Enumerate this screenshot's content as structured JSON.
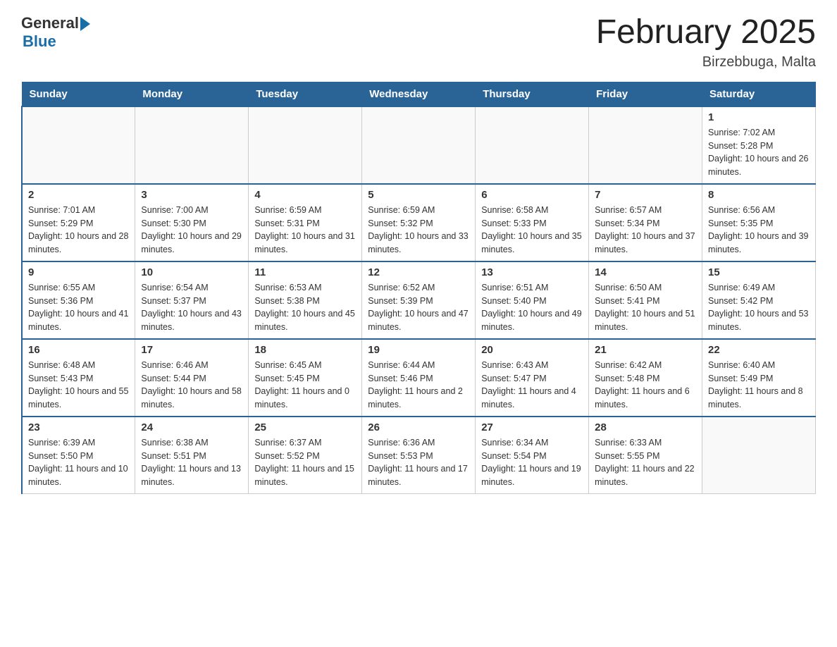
{
  "logo": {
    "general_text": "General",
    "blue_text": "Blue"
  },
  "title": "February 2025",
  "location": "Birzebbuga, Malta",
  "days_of_week": [
    "Sunday",
    "Monday",
    "Tuesday",
    "Wednesday",
    "Thursday",
    "Friday",
    "Saturday"
  ],
  "weeks": [
    [
      {
        "day": "",
        "info": ""
      },
      {
        "day": "",
        "info": ""
      },
      {
        "day": "",
        "info": ""
      },
      {
        "day": "",
        "info": ""
      },
      {
        "day": "",
        "info": ""
      },
      {
        "day": "",
        "info": ""
      },
      {
        "day": "1",
        "info": "Sunrise: 7:02 AM\nSunset: 5:28 PM\nDaylight: 10 hours and 26 minutes."
      }
    ],
    [
      {
        "day": "2",
        "info": "Sunrise: 7:01 AM\nSunset: 5:29 PM\nDaylight: 10 hours and 28 minutes."
      },
      {
        "day": "3",
        "info": "Sunrise: 7:00 AM\nSunset: 5:30 PM\nDaylight: 10 hours and 29 minutes."
      },
      {
        "day": "4",
        "info": "Sunrise: 6:59 AM\nSunset: 5:31 PM\nDaylight: 10 hours and 31 minutes."
      },
      {
        "day": "5",
        "info": "Sunrise: 6:59 AM\nSunset: 5:32 PM\nDaylight: 10 hours and 33 minutes."
      },
      {
        "day": "6",
        "info": "Sunrise: 6:58 AM\nSunset: 5:33 PM\nDaylight: 10 hours and 35 minutes."
      },
      {
        "day": "7",
        "info": "Sunrise: 6:57 AM\nSunset: 5:34 PM\nDaylight: 10 hours and 37 minutes."
      },
      {
        "day": "8",
        "info": "Sunrise: 6:56 AM\nSunset: 5:35 PM\nDaylight: 10 hours and 39 minutes."
      }
    ],
    [
      {
        "day": "9",
        "info": "Sunrise: 6:55 AM\nSunset: 5:36 PM\nDaylight: 10 hours and 41 minutes."
      },
      {
        "day": "10",
        "info": "Sunrise: 6:54 AM\nSunset: 5:37 PM\nDaylight: 10 hours and 43 minutes."
      },
      {
        "day": "11",
        "info": "Sunrise: 6:53 AM\nSunset: 5:38 PM\nDaylight: 10 hours and 45 minutes."
      },
      {
        "day": "12",
        "info": "Sunrise: 6:52 AM\nSunset: 5:39 PM\nDaylight: 10 hours and 47 minutes."
      },
      {
        "day": "13",
        "info": "Sunrise: 6:51 AM\nSunset: 5:40 PM\nDaylight: 10 hours and 49 minutes."
      },
      {
        "day": "14",
        "info": "Sunrise: 6:50 AM\nSunset: 5:41 PM\nDaylight: 10 hours and 51 minutes."
      },
      {
        "day": "15",
        "info": "Sunrise: 6:49 AM\nSunset: 5:42 PM\nDaylight: 10 hours and 53 minutes."
      }
    ],
    [
      {
        "day": "16",
        "info": "Sunrise: 6:48 AM\nSunset: 5:43 PM\nDaylight: 10 hours and 55 minutes."
      },
      {
        "day": "17",
        "info": "Sunrise: 6:46 AM\nSunset: 5:44 PM\nDaylight: 10 hours and 58 minutes."
      },
      {
        "day": "18",
        "info": "Sunrise: 6:45 AM\nSunset: 5:45 PM\nDaylight: 11 hours and 0 minutes."
      },
      {
        "day": "19",
        "info": "Sunrise: 6:44 AM\nSunset: 5:46 PM\nDaylight: 11 hours and 2 minutes."
      },
      {
        "day": "20",
        "info": "Sunrise: 6:43 AM\nSunset: 5:47 PM\nDaylight: 11 hours and 4 minutes."
      },
      {
        "day": "21",
        "info": "Sunrise: 6:42 AM\nSunset: 5:48 PM\nDaylight: 11 hours and 6 minutes."
      },
      {
        "day": "22",
        "info": "Sunrise: 6:40 AM\nSunset: 5:49 PM\nDaylight: 11 hours and 8 minutes."
      }
    ],
    [
      {
        "day": "23",
        "info": "Sunrise: 6:39 AM\nSunset: 5:50 PM\nDaylight: 11 hours and 10 minutes."
      },
      {
        "day": "24",
        "info": "Sunrise: 6:38 AM\nSunset: 5:51 PM\nDaylight: 11 hours and 13 minutes."
      },
      {
        "day": "25",
        "info": "Sunrise: 6:37 AM\nSunset: 5:52 PM\nDaylight: 11 hours and 15 minutes."
      },
      {
        "day": "26",
        "info": "Sunrise: 6:36 AM\nSunset: 5:53 PM\nDaylight: 11 hours and 17 minutes."
      },
      {
        "day": "27",
        "info": "Sunrise: 6:34 AM\nSunset: 5:54 PM\nDaylight: 11 hours and 19 minutes."
      },
      {
        "day": "28",
        "info": "Sunrise: 6:33 AM\nSunset: 5:55 PM\nDaylight: 11 hours and 22 minutes."
      },
      {
        "day": "",
        "info": ""
      }
    ]
  ]
}
